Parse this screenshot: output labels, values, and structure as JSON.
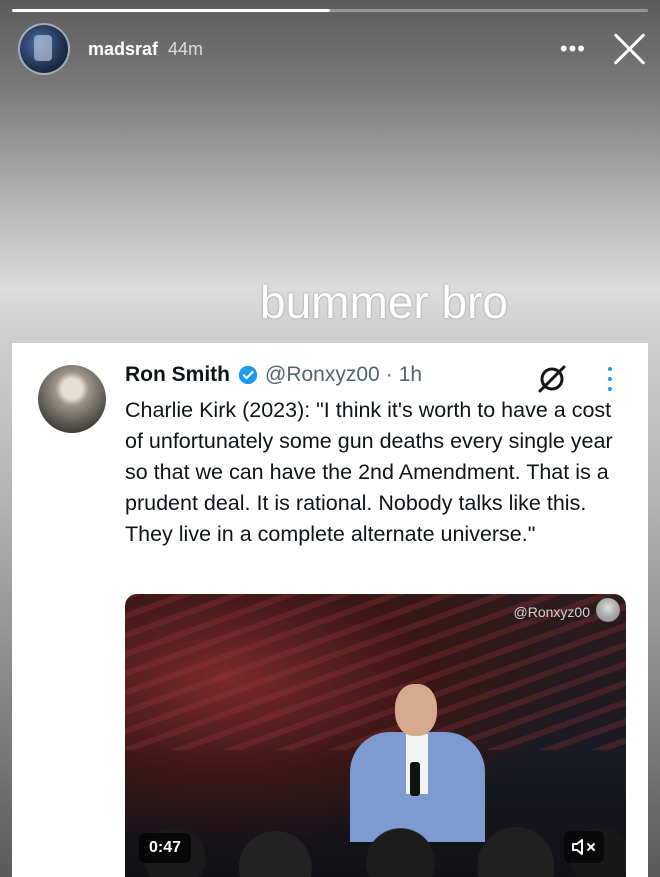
{
  "story": {
    "progress_fraction": 0.5,
    "username": "madsraf",
    "time_ago": "44m",
    "text": "bummer bro"
  },
  "post": {
    "author": "Ron Smith",
    "handle": "@Ronxyz00",
    "separator": "·",
    "time": "1h",
    "text": "Charlie Kirk (2023): \"I think it's worth to have a cost of unfortunately some gun deaths every single year so that we can have the 2nd Amendment. That is a prudent deal. It is rational. Nobody talks like this. They live in a complete alternate universe.\"",
    "video": {
      "watermark": "@Ronxyz00",
      "duration": "0:47"
    }
  },
  "colors": {
    "accent": "#1d9bf0",
    "text": "#0f1419",
    "secondary_text": "#536471"
  },
  "icons": [
    "more-icon",
    "close-icon",
    "verified-icon",
    "grok-icon",
    "kebab-icon",
    "mute-icon"
  ]
}
